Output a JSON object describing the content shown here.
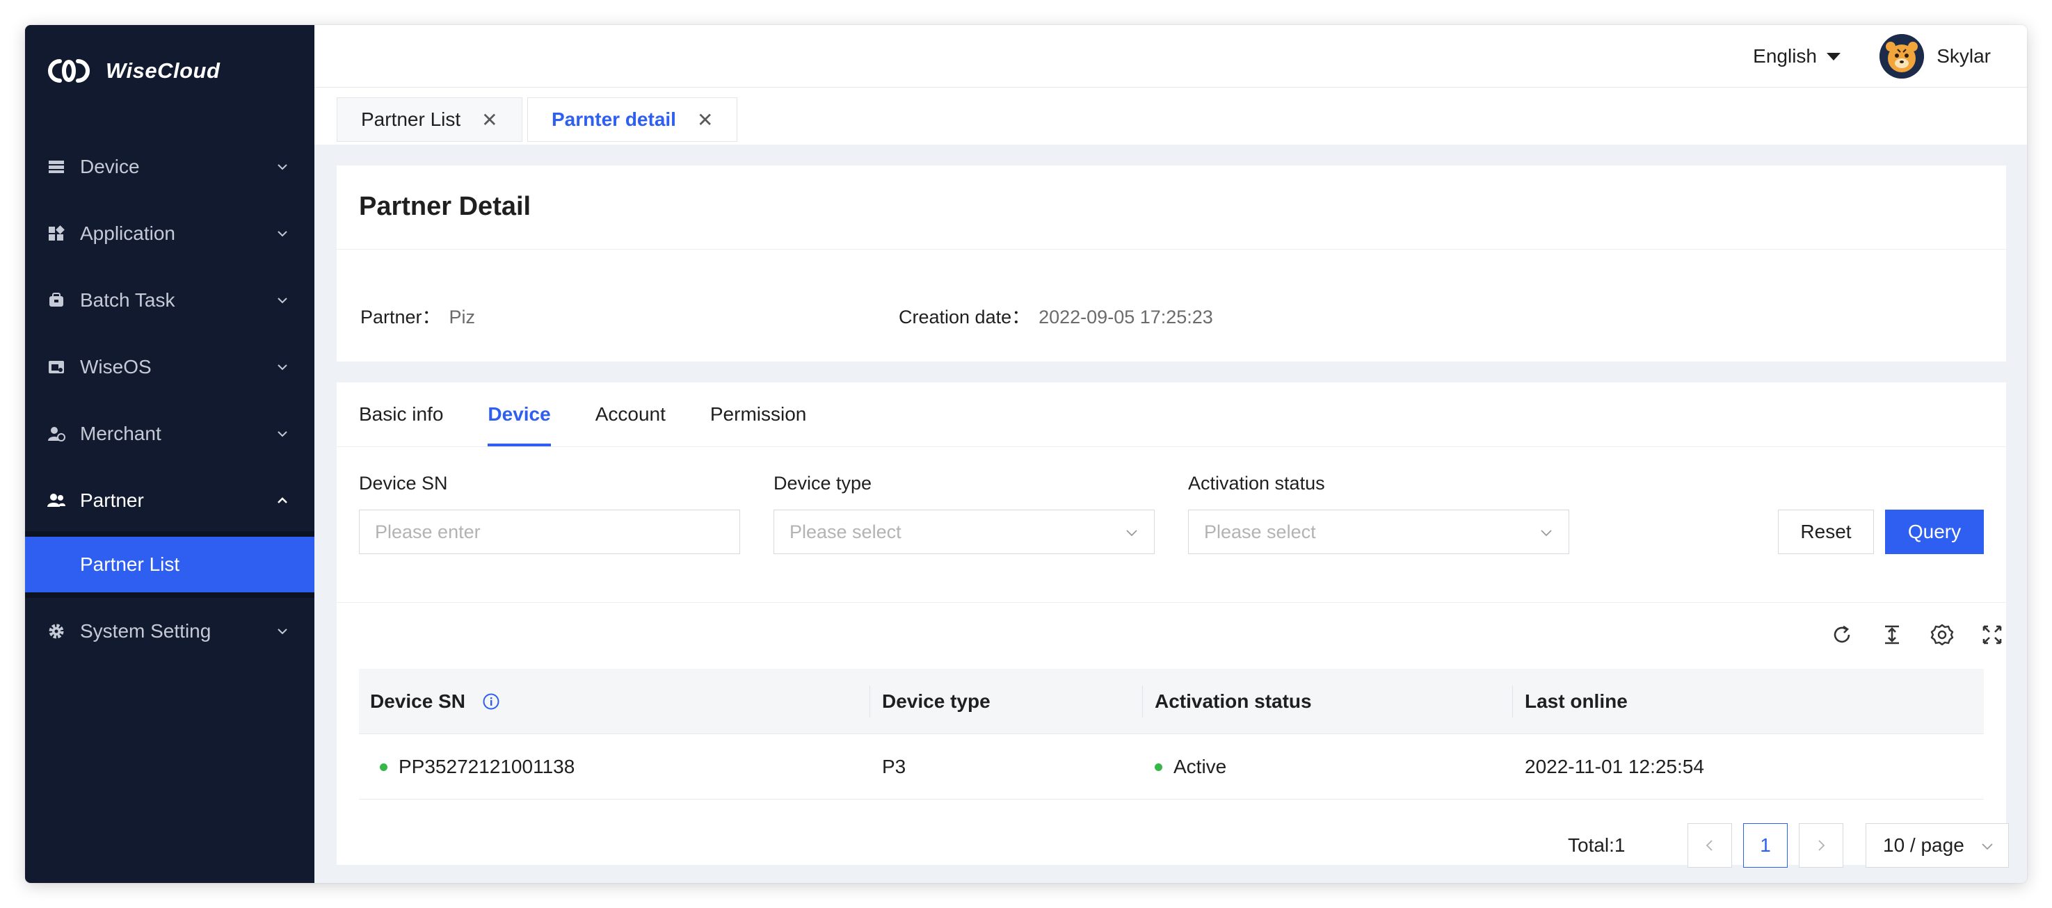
{
  "app": {
    "name": "WiseCloud"
  },
  "colors": {
    "accent": "#2f5ff0",
    "sidebar_bg": "#111a2e",
    "status_active": "#35b84a"
  },
  "sidebar": {
    "items": [
      {
        "label": "Device",
        "icon": "device-icon"
      },
      {
        "label": "Application",
        "icon": "application-icon"
      },
      {
        "label": "Batch Task",
        "icon": "batch-task-icon"
      },
      {
        "label": "WiseOS",
        "icon": "wiseos-icon"
      },
      {
        "label": "Merchant",
        "icon": "merchant-icon"
      },
      {
        "label": "Partner",
        "icon": "partner-icon",
        "expanded": true,
        "children": [
          {
            "label": "Partner List",
            "selected": true
          }
        ]
      },
      {
        "label": "System Setting",
        "icon": "gear-icon"
      }
    ]
  },
  "header": {
    "language": "English",
    "username": "Skylar"
  },
  "tabs": [
    {
      "label": "Partner List",
      "active": false
    },
    {
      "label": "Parnter detail",
      "active": true
    }
  ],
  "detail": {
    "title": "Partner Detail",
    "partner_label": "Partner：",
    "partner_value": "Piz",
    "creation_label": "Creation date：",
    "creation_value": "2022-09-05 17:25:23"
  },
  "detail_tabs": [
    {
      "label": "Basic info",
      "active": false
    },
    {
      "label": "Device",
      "active": true
    },
    {
      "label": "Account",
      "active": false
    },
    {
      "label": "Permission",
      "active": false
    }
  ],
  "filters": {
    "device_sn": {
      "label": "Device SN",
      "placeholder": "Please enter",
      "value": ""
    },
    "device_type": {
      "label": "Device type",
      "placeholder": "Please select",
      "value": ""
    },
    "activation_status": {
      "label": "Activation status",
      "placeholder": "Please select",
      "value": ""
    },
    "reset_label": "Reset",
    "query_label": "Query"
  },
  "table": {
    "columns": [
      "Device SN",
      "Device type",
      "Activation status",
      "Last online"
    ],
    "rows": [
      {
        "device_sn": "PP35272121001138",
        "device_type": "P3",
        "activation_status": "Active",
        "last_online": "2022-11-01 12:25:54"
      }
    ]
  },
  "pagination": {
    "total_text": "Total:1",
    "current_page": "1",
    "page_size": "10 / page"
  }
}
